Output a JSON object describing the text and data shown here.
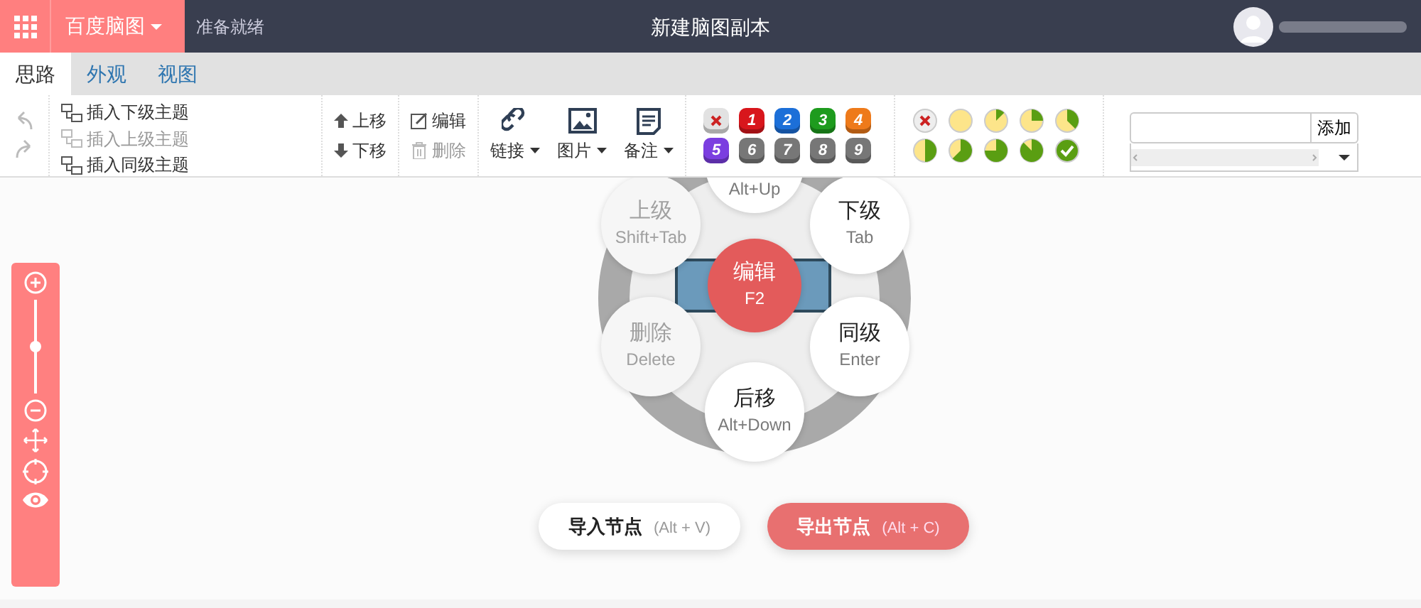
{
  "app": {
    "brand": "百度脑图",
    "status": "准备就绪",
    "title": "新建脑图副本"
  },
  "tabs": [
    {
      "label": "思路",
      "selected": true
    },
    {
      "label": "外观",
      "selected": false
    },
    {
      "label": "视图",
      "selected": false
    }
  ],
  "insert": [
    {
      "label": "插入下级主题",
      "disabled": false
    },
    {
      "label": "插入上级主题",
      "disabled": true
    },
    {
      "label": "插入同级主题",
      "disabled": false
    }
  ],
  "move": [
    {
      "label": "上移",
      "kind": "up"
    },
    {
      "label": "下移",
      "kind": "down"
    }
  ],
  "edit": [
    {
      "label": "编辑",
      "kind": "edit",
      "disabled": false
    },
    {
      "label": "删除",
      "kind": "delete",
      "disabled": true
    }
  ],
  "attach": [
    {
      "label": "链接",
      "kind": "link"
    },
    {
      "label": "图片",
      "kind": "image"
    },
    {
      "label": "备注",
      "kind": "note"
    }
  ],
  "priorities": [
    {
      "kind": "clear",
      "color": "#e2e2e2"
    },
    {
      "kind": "number",
      "label": "1",
      "color": "#d8161c"
    },
    {
      "kind": "number",
      "label": "2",
      "color": "#1c6fd8"
    },
    {
      "kind": "number",
      "label": "3",
      "color": "#1e9b1e"
    },
    {
      "kind": "number",
      "label": "4",
      "color": "#ee7a1a"
    },
    {
      "kind": "number",
      "label": "5",
      "color": "#7b3ee0"
    },
    {
      "kind": "number",
      "label": "6",
      "color": "#777777"
    },
    {
      "kind": "number",
      "label": "7",
      "color": "#777777"
    },
    {
      "kind": "number",
      "label": "8",
      "color": "#777777"
    },
    {
      "kind": "number",
      "label": "9",
      "color": "#777777"
    }
  ],
  "progress": [
    {
      "kind": "clear"
    },
    {
      "kind": "empty"
    },
    {
      "kind": "eighth"
    },
    {
      "kind": "quarter"
    },
    {
      "kind": "threeeighths"
    },
    {
      "kind": "half"
    },
    {
      "kind": "fiveeighths"
    },
    {
      "kind": "threequarters"
    },
    {
      "kind": "seveneighths"
    },
    {
      "kind": "done"
    }
  ],
  "resource": {
    "button": "添加"
  },
  "zoom": {
    "level": 0.5
  },
  "radial": [
    {
      "kind": "top",
      "key": "Alt+Up",
      "disabled": false
    },
    {
      "kind": "upperleft",
      "title": "上级",
      "key": "Shift+Tab",
      "disabled": true
    },
    {
      "kind": "upperright",
      "title": "下级",
      "key": "Tab",
      "disabled": false
    },
    {
      "kind": "center",
      "title": "编辑",
      "key": "F2"
    },
    {
      "kind": "lowerleft",
      "title": "删除",
      "key": "Delete",
      "disabled": true
    },
    {
      "kind": "lowerright",
      "title": "同级",
      "key": "Enter",
      "disabled": false
    },
    {
      "kind": "bottom",
      "title": "后移",
      "key": "Alt+Down",
      "disabled": false
    }
  ],
  "buttons": [
    {
      "kind": "import",
      "label": "导入节点",
      "shortcut": "(Alt + V)"
    },
    {
      "kind": "export",
      "label": "导出节点",
      "shortcut": "(Alt + C)"
    }
  ]
}
